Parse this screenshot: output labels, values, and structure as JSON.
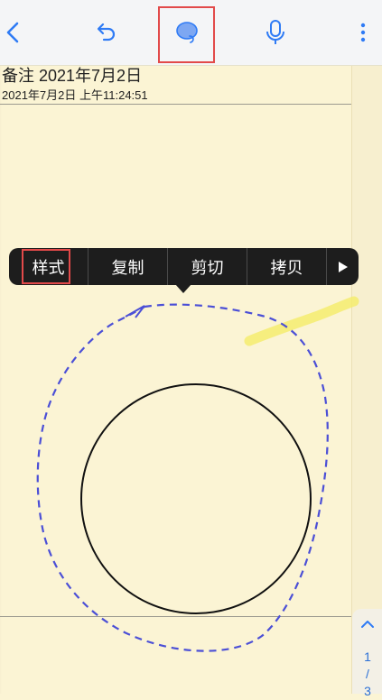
{
  "toolbar": {
    "icons": [
      "back-icon",
      "undo-icon",
      "lasso-icon",
      "microphone-icon",
      "more-icon"
    ],
    "accent": "#2f7bf5",
    "highlight": "#e24a4a"
  },
  "note": {
    "title": "备注 2021年7月2日",
    "timestamp": "2021年7月2日 上午11:24:51"
  },
  "context_menu": {
    "items": [
      "样式",
      "复制",
      "剪切",
      "拷贝"
    ],
    "more_icon": "triangle-right-icon"
  },
  "pager": {
    "current": "1",
    "separator": "/",
    "total": "3"
  }
}
